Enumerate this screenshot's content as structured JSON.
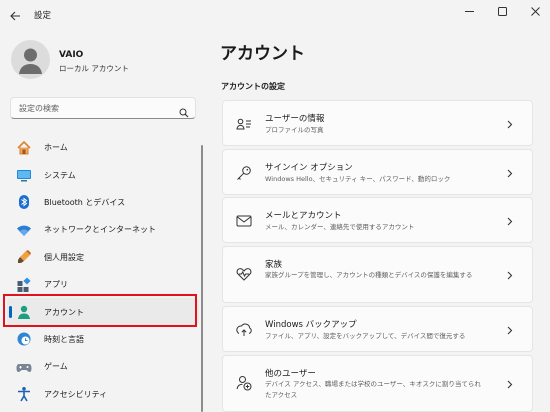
{
  "window": {
    "title": "設定"
  },
  "user": {
    "name": "VAIO",
    "account_type": "ローカル アカウント"
  },
  "search": {
    "placeholder": "設定の検索"
  },
  "nav": {
    "items": [
      {
        "label": "ホーム",
        "icon": "home-icon"
      },
      {
        "label": "システム",
        "icon": "system-icon"
      },
      {
        "label": "Bluetooth とデバイス",
        "icon": "bluetooth-icon"
      },
      {
        "label": "ネットワークとインターネット",
        "icon": "wifi-icon"
      },
      {
        "label": "個人用設定",
        "icon": "paintbrush-icon"
      },
      {
        "label": "アプリ",
        "icon": "apps-icon"
      },
      {
        "label": "アカウント",
        "icon": "account-icon",
        "active": true
      },
      {
        "label": "時刻と言語",
        "icon": "clock-globe-icon"
      },
      {
        "label": "ゲーム",
        "icon": "gamepad-icon"
      },
      {
        "label": "アクセシビリティ",
        "icon": "accessibility-icon"
      }
    ]
  },
  "main": {
    "title": "アカウント",
    "section_title": "アカウントの設定",
    "cards": [
      {
        "title": "ユーザーの情報",
        "desc": "プロファイルの写真",
        "icon": "user-info-icon"
      },
      {
        "title": "サインイン オプション",
        "desc": "Windows Hello、セキュリティ キー、パスワード、動的ロック",
        "icon": "key-icon"
      },
      {
        "title": "メールとアカウント",
        "desc": "メール、カレンダー、連絡先で使用するアカウント",
        "icon": "mail-icon"
      },
      {
        "title": "家族",
        "desc": "家族グループを管理し、アカウントの種類とデバイスの保護を編集する",
        "icon": "family-heart-icon"
      },
      {
        "title": "Windows バックアップ",
        "desc": "ファイル、アプリ、設定をバックアップして、デバイス間で復元する",
        "icon": "backup-icon"
      },
      {
        "title": "他のユーザー",
        "desc": "デバイス アクセス、職場または学校のユーザー、キオスクに割り当てられたアクセス",
        "icon": "add-user-icon"
      }
    ]
  },
  "colors": {
    "accent": "#0067c0",
    "highlight": "#e0121b",
    "background": "#f3f3f3",
    "card": "#fbfbfb"
  }
}
